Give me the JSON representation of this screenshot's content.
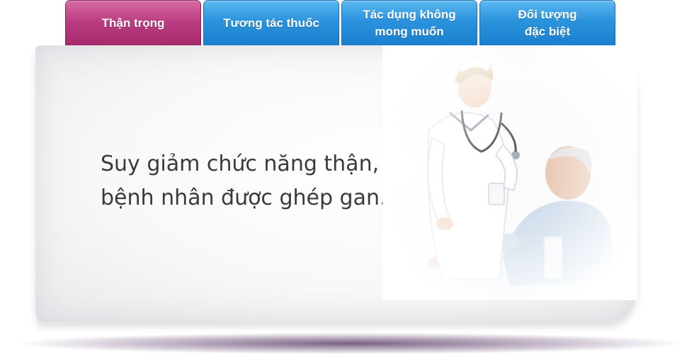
{
  "tabs": [
    {
      "label": "Thận trọng",
      "active": true
    },
    {
      "label": "Tương tác thuốc",
      "active": false
    },
    {
      "label": "Tác dụng không\nmong muốn",
      "active": false
    },
    {
      "label": "Đối tượng\nđặc biệt",
      "active": false
    }
  ],
  "content": {
    "line1": "Suy giảm chức năng thận,",
    "line2": "bệnh nhân được ghép gan."
  },
  "colors": {
    "active_tab": "#b93b80",
    "tab": "#2b93de",
    "text": "#3a3a3a"
  }
}
